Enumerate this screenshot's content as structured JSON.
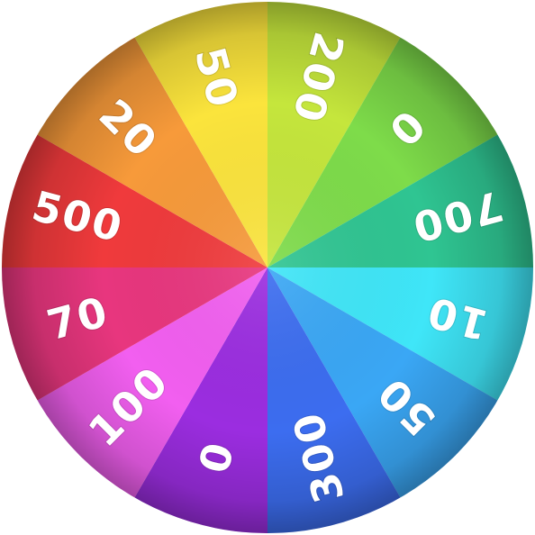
{
  "wheel": {
    "segments": [
      {
        "label": "200",
        "color": "#c5e63c"
      },
      {
        "label": "0",
        "color": "#7edc4a"
      },
      {
        "label": "700",
        "color": "#2fc592"
      },
      {
        "label": "10",
        "color": "#3fe6f8"
      },
      {
        "label": "50",
        "color": "#3aa7f5"
      },
      {
        "label": "300",
        "color": "#3c6df0"
      },
      {
        "label": "0",
        "color": "#9b2de0"
      },
      {
        "label": "100",
        "color": "#f25ff0"
      },
      {
        "label": "70",
        "color": "#e8367e"
      },
      {
        "label": "500",
        "color": "#f03a3c"
      },
      {
        "label": "20",
        "color": "#f79a3a"
      },
      {
        "label": "50",
        "color": "#fbe43c"
      }
    ]
  }
}
